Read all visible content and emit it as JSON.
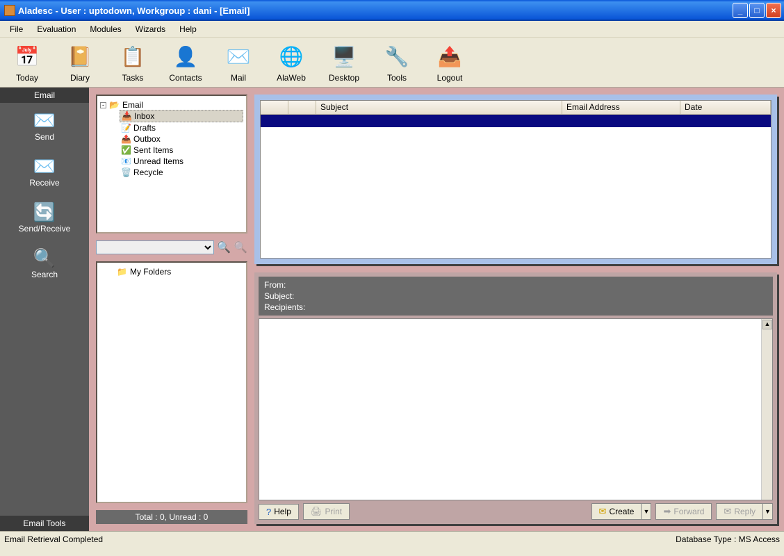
{
  "titlebar": {
    "title": "Aladesc - User : uptodown, Workgroup : dani - [Email]"
  },
  "menu": {
    "file": "File",
    "evaluation": "Evaluation",
    "modules": "Modules",
    "wizards": "Wizards",
    "help": "Help"
  },
  "toolbar": {
    "today": "Today",
    "diary": "Diary",
    "tasks": "Tasks",
    "contacts": "Contacts",
    "mail": "Mail",
    "alaweb": "AlaWeb",
    "desktop": "Desktop",
    "tools": "Tools",
    "logout": "Logout"
  },
  "sidebar": {
    "top_tab": "Email",
    "bottom_tab": "Email Tools",
    "send": "Send",
    "receive": "Receive",
    "sendreceive": "Send/Receive",
    "search": "Search"
  },
  "tree": {
    "root": "Email",
    "inbox": "Inbox",
    "drafts": "Drafts",
    "outbox": "Outbox",
    "sent": "Sent Items",
    "unread": "Unread Items",
    "recycle": "Recycle"
  },
  "myfolders": {
    "label": "My Folders",
    "status": "Total : 0, Unread : 0"
  },
  "list": {
    "col_subject": "Subject",
    "col_address": "Email Address",
    "col_date": "Date"
  },
  "preview": {
    "from_label": "From:",
    "subject_label": "Subject:",
    "recipients_label": "Recipients:",
    "help": "Help",
    "print": "Print",
    "create": "Create",
    "forward": "Forward",
    "reply": "Reply"
  },
  "statusbar": {
    "left": "Email Retrieval Completed",
    "right": "Database Type : MS Access"
  }
}
